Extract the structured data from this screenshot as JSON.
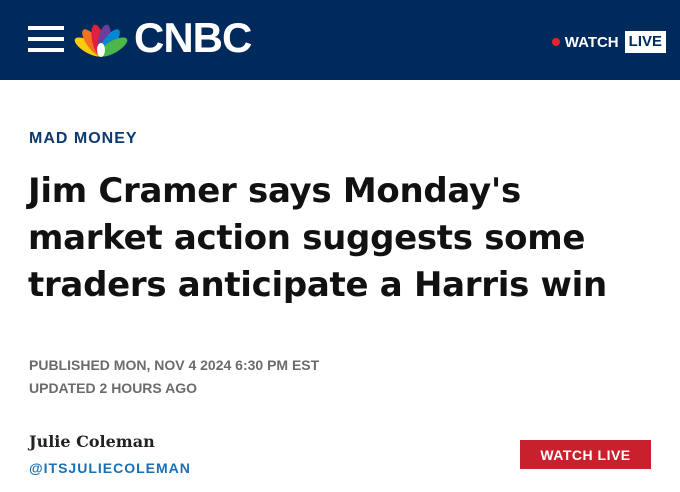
{
  "header": {
    "brand": "CNBC",
    "watch_label": "WATCH",
    "live_label": "LIVE"
  },
  "article": {
    "section": "MAD MONEY",
    "headline": "Jim Cramer says Monday's market action suggests some traders anticipate a Harris win",
    "published": "PUBLISHED MON, NOV 4 2024 6:30 PM EST",
    "updated": "UPDATED 2 HOURS AGO",
    "author": "Julie Coleman",
    "author_handle": "@ITSJULIECOLEMAN",
    "watch_live_button": "WATCH LIVE"
  },
  "colors": {
    "header_bg": "#002a5c",
    "live_dot": "#e8242b",
    "section": "#0b3a6f",
    "handle": "#1a6fb5",
    "watch_live_button": "#c8202c"
  },
  "icons": {
    "menu": "hamburger-menu-icon",
    "logo": "nbc-peacock-icon"
  }
}
